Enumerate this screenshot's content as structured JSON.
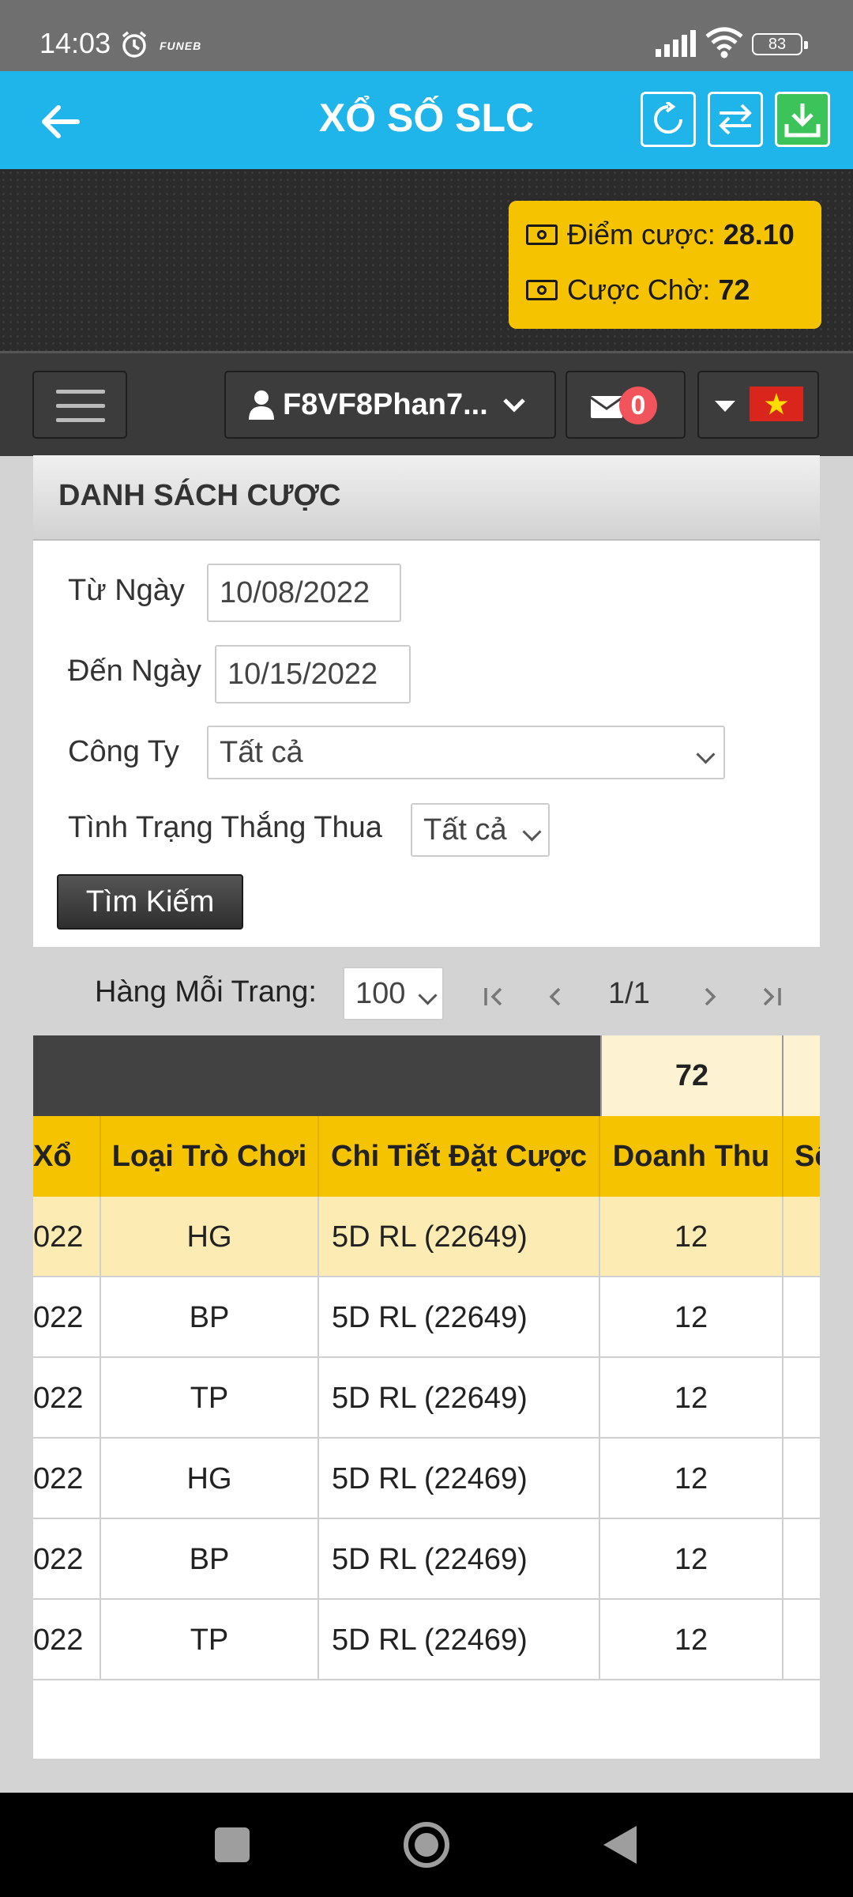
{
  "status_bar": {
    "time": "14:03",
    "brand": "FUNEB",
    "battery": "83"
  },
  "app_bar": {
    "title": "XỔ SỐ SLC",
    "icons": [
      "back-arrow-icon",
      "refresh-icon",
      "swap-icon",
      "download-icon"
    ]
  },
  "points": {
    "bet_label": "Điểm cược:",
    "bet_value": "28.10",
    "pending_label": "Cược Chờ:",
    "pending_value": "72"
  },
  "nav": {
    "username": "F8VF8Phan7...",
    "messages": "0"
  },
  "panel": {
    "title": "DANH SÁCH CƯỢC"
  },
  "filters": {
    "from_label": "Từ Ngày",
    "from_value": "10/08/2022",
    "to_label": "Đến Ngày",
    "to_value": "10/15/2022",
    "company_label": "Công Ty",
    "company_value": "Tất cả",
    "result_label": "Tình Trạng Thắng Thua",
    "result_value": "Tất cả",
    "search_label": "Tìm Kiếm"
  },
  "pager": {
    "rows_label": "Hàng Mỗi Trang:",
    "rows_value": "100",
    "page": "1/1"
  },
  "table": {
    "total": "72",
    "headers": [
      "Xổ",
      "Loại Trò Chơi",
      "Chi Tiết Đặt Cược",
      "Doanh Thu",
      "Số"
    ],
    "rows": [
      {
        "date": "022",
        "type": "HG",
        "detail": "5D RL (22649)",
        "revenue": "12"
      },
      {
        "date": "022",
        "type": "BP",
        "detail": "5D RL (22649)",
        "revenue": "12"
      },
      {
        "date": "022",
        "type": "TP",
        "detail": "5D RL (22649)",
        "revenue": "12"
      },
      {
        "date": "022",
        "type": "HG",
        "detail": "5D RL (22469)",
        "revenue": "12"
      },
      {
        "date": "022",
        "type": "BP",
        "detail": "5D RL (22469)",
        "revenue": "12"
      },
      {
        "date": "022",
        "type": "TP",
        "detail": "5D RL (22469)",
        "revenue": "12"
      }
    ]
  },
  "colors": {
    "app_bar": "#1fb4ea",
    "accent": "#f5c300",
    "highlight_row": "#fcecb4",
    "total_cell": "#fdf3d3",
    "download": "#3cc45a",
    "badge": "#f2545b"
  }
}
